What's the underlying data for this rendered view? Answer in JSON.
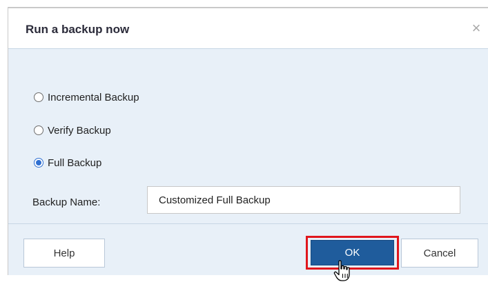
{
  "dialog": {
    "title": "Run a backup now",
    "close_icon": "close-icon"
  },
  "options": [
    {
      "label": "Incremental Backup",
      "checked": false
    },
    {
      "label": "Verify Backup",
      "checked": false
    },
    {
      "label": "Full Backup",
      "checked": true
    }
  ],
  "backup_name": {
    "label": "Backup Name:",
    "value": "Customized Full Backup"
  },
  "buttons": {
    "help": "Help",
    "ok": "OK",
    "cancel": "Cancel"
  },
  "colors": {
    "highlight": "#e0161c",
    "primary": "#1f5c9c",
    "dialog_bg": "#e8f0f8"
  }
}
